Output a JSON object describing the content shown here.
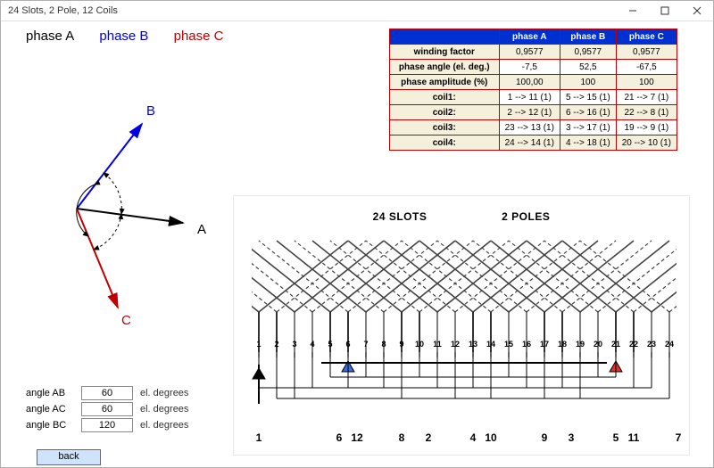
{
  "window": {
    "title": "24 Slots, 2 Pole, 12 Coils"
  },
  "phases": {
    "A": "phase A",
    "B": "phase B",
    "C": "phase C"
  },
  "phasor": {
    "A": "A",
    "B": "B",
    "C": "C"
  },
  "angles": {
    "rows": [
      {
        "label": "angle AB",
        "value": "60",
        "unit": "el. degrees"
      },
      {
        "label": "angle AC",
        "value": "60",
        "unit": "el. degrees"
      },
      {
        "label": "angle BC",
        "value": "120",
        "unit": "el. degrees"
      }
    ]
  },
  "back_btn": "back",
  "table": {
    "headers": [
      "",
      "phase A",
      "phase B",
      "phase C"
    ],
    "rows": [
      {
        "h": "winding factor",
        "a": "0,9577",
        "b": "0,9577",
        "c": "0,9577",
        "alt": true
      },
      {
        "h": "phase angle (el. deg.)",
        "a": "-7,5",
        "b": "52,5",
        "c": "-67,5",
        "alt": false
      },
      {
        "h": "phase amplitude (%)",
        "a": "100,00",
        "b": "100",
        "c": "100",
        "alt": true
      },
      {
        "h": "coil1:",
        "a": "1 --> 11 (1)",
        "b": "5 --> 15 (1)",
        "c": "21 --> 7 (1)",
        "alt": false
      },
      {
        "h": "coil2:",
        "a": "2 --> 12 (1)",
        "b": "6 --> 16 (1)",
        "c": "22 --> 8 (1)",
        "alt": true
      },
      {
        "h": "coil3:",
        "a": "23 --> 13 (1)",
        "b": "3 --> 17 (1)",
        "c": "19 --> 9 (1)",
        "alt": false
      },
      {
        "h": "coil4:",
        "a": "24 --> 14 (1)",
        "b": "4 --> 18 (1)",
        "c": "20 --> 10 (1)",
        "alt": true
      }
    ]
  },
  "diagram": {
    "title_slots": "24 SLOTS",
    "title_poles": "2 POLES",
    "slot_numbers": [
      "1",
      "2",
      "3",
      "4",
      "5",
      "6",
      "7",
      "8",
      "9",
      "10",
      "11",
      "12",
      "13",
      "14",
      "15",
      "16",
      "17",
      "18",
      "19",
      "20",
      "21",
      "22",
      "23",
      "24"
    ],
    "bottom_numbers": [
      "1",
      "6",
      "12",
      "8",
      "2",
      "4",
      "10",
      "9",
      "3",
      "5",
      "11",
      "7"
    ]
  }
}
